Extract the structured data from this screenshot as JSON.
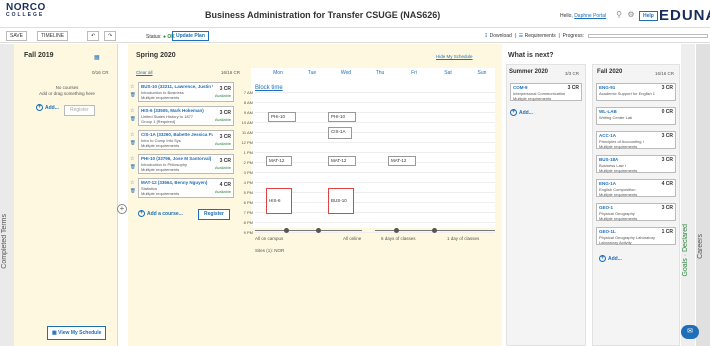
{
  "header": {
    "logo_main": "NORCO",
    "logo_sub": "COLLEGE",
    "title": "Business Administration for Transfer CSUGE (NAS626)",
    "hello_prefix": "Hello,",
    "user_name": "Daphne Portal",
    "help_label": "Help",
    "brand": "EDUNAV"
  },
  "toolbar": {
    "save_label": "SAVE",
    "timeline_label": "TIMELINE",
    "undo_glyph": "↶",
    "redo_glyph": "↷",
    "status_label": "Status:",
    "status_value": "OK",
    "update_plan_label": "Update Plan",
    "download_label": "Download",
    "requirements_label": "Requirements",
    "progress_label": "Progress:"
  },
  "sidebar": {
    "completed_terms_label": "Completed Terms",
    "goals_label": "Goals · Declared",
    "careers_label": "Careers"
  },
  "fall2019": {
    "title": "Fall 2019",
    "credits": "0/16 CR",
    "empty_line1": "No courses",
    "empty_line2": "Add or drag something here",
    "add_label": "Add...",
    "register_label": "Register",
    "view_schedule_label": "View My Schedule"
  },
  "spring2020": {
    "title": "Spring 2020",
    "clear_all_label": "Clear all",
    "credits": "16/16 CR",
    "hide_schedule_label": "Hide My Schedule",
    "courses": [
      {
        "code": "BUS-10 (32211, Lawrence, Justin W...",
        "line1": "Introduction to Business",
        "line2": "Multiple requirements",
        "cr": "3 CR",
        "status": "Available"
      },
      {
        "code": "HIS-6 (33505, Mark Hokeman)",
        "line1": "United States History to 1877",
        "line2": "Group 1 [Required]",
        "cr": "3 CR",
        "status": "Available"
      },
      {
        "code": "CIS-1A (33260, Babette Jessica Full...",
        "line1": "Intro to Comp Info Sys",
        "line2": "Multiple requirements",
        "cr": "3 CR",
        "status": "Available"
      },
      {
        "code": "PHI-10 (33796, Jose M Santorval)",
        "line1": "Introduction to Philosophy",
        "line2": "Multiple requirements",
        "cr": "3 CR",
        "status": "Available"
      },
      {
        "code": "MAT-12 (33664, Benny Nguyen)",
        "line1": "Statistics",
        "line2": "Multiple requirements",
        "cr": "4 CR",
        "status": "Available"
      }
    ],
    "add_course_label": "Add a course...",
    "register_label": "Register"
  },
  "calendar": {
    "days": [
      "Mon",
      "Tue",
      "Wed",
      "Thu",
      "Fri",
      "Sat",
      "Sun"
    ],
    "hours": [
      "7 AM",
      "8 AM",
      "9 AM",
      "10 AM",
      "11 AM",
      "12 PM",
      "1 PM",
      "2 PM",
      "3 PM",
      "4 PM",
      "5 PM",
      "6 PM",
      "7 PM",
      "8 PM",
      "9 PM"
    ],
    "block_time_label": "Block time",
    "blocks": [
      "PHI-10",
      "PHI-10",
      "CIS-1A",
      "MAT-12",
      "MAT-12",
      "MAT-12",
      "HIS-6",
      "BUS-10"
    ],
    "slider_labels": [
      "All on campus",
      "All online",
      "6 days of classes",
      "1 day of classes"
    ],
    "sites_label": "Sites (1): NOR"
  },
  "whats_next": {
    "title": "What is next?",
    "summer": {
      "title": "Summer 2020",
      "credits": "3/3 CR",
      "add_label": "Add...",
      "courses": [
        {
          "code": "COM-9",
          "line1": "Interpersonal Communication",
          "line2": "Multiple requirements",
          "cr": "3 CR"
        }
      ]
    },
    "fall2020": {
      "title": "Fall 2020",
      "credits": "16/16 CR",
      "add_label": "Add...",
      "courses": [
        {
          "code": "ENG-91",
          "line1": "Academic Support for English 1",
          "line2": "",
          "cr": "3 CR"
        },
        {
          "code": "WL-LAB",
          "line1": "Writing Center Lab",
          "line2": "",
          "cr": "0 CR"
        },
        {
          "code": "ACC-1A",
          "line1": "Principles of Accounting I",
          "line2": "Multiple requirements",
          "cr": "3 CR"
        },
        {
          "code": "BUS-18A",
          "line1": "Business Law I",
          "line2": "Multiple requirements",
          "cr": "3 CR"
        },
        {
          "code": "ENG-1A",
          "line1": "English Composition",
          "line2": "Multiple requirements",
          "cr": "4 CR"
        },
        {
          "code": "GEO-1",
          "line1": "Physical Geography",
          "line2": "Multiple requirements",
          "cr": "3 CR"
        },
        {
          "code": "GEO-1L",
          "line1": "Physical Geography Laboratory",
          "line2": "Laboratory Activity",
          "cr": "1 CR"
        }
      ]
    }
  },
  "colors": {
    "accent": "#1e6fb8",
    "brand": "#1a2d5a",
    "ok": "#2e8540",
    "term_bg": "#fdf8df"
  },
  "icons": {
    "search": "search-icon",
    "gear": "gear-icon",
    "calendar": "calendar-icon",
    "star": "star-icon",
    "trash": "trash-icon",
    "chat": "chat-icon"
  }
}
